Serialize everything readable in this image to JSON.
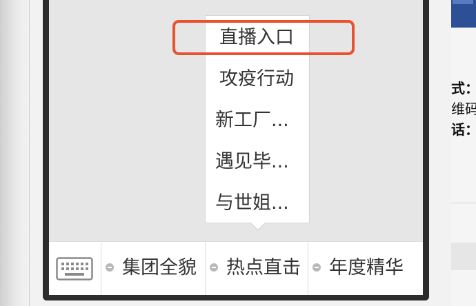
{
  "submenu": {
    "items": [
      {
        "label": "直播入口"
      },
      {
        "label": "攻疫行动"
      },
      {
        "label": "新工厂..."
      },
      {
        "label": "遇见毕..."
      },
      {
        "label": "与世姐..."
      }
    ],
    "highlighted_index": 0,
    "highlight_color": "#e8522e"
  },
  "menubar": {
    "keyboard_icon": "keyboard-icon",
    "items": [
      {
        "label": "集团全貌"
      },
      {
        "label": "热点直击"
      },
      {
        "label": "年度精华"
      }
    ]
  },
  "background_page": {
    "line1": "式：",
    "line2": "维码",
    "line3": "话："
  },
  "colors": {
    "screen_bg": "#e6e6e6",
    "frame": "#2c2c2c",
    "accent_blue": "#2d4f96"
  }
}
